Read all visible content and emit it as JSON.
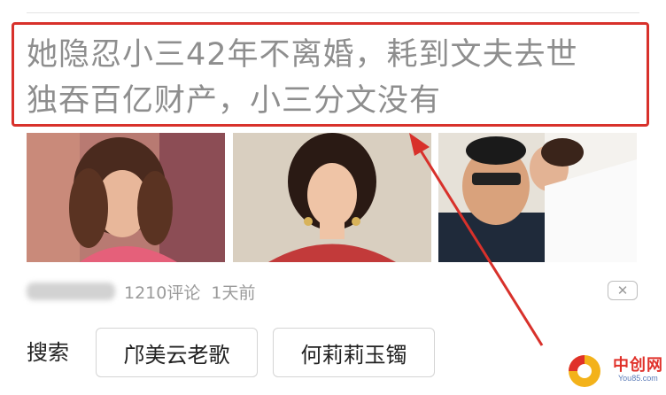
{
  "article": {
    "headline_line1": "她隐忍小三42年不离婚，耗到文夫去世",
    "headline_line2": "独吞百亿财产，小三分文没有"
  },
  "meta": {
    "comments": "1210评论",
    "time": "1天前",
    "close_glyph": "✕"
  },
  "search": {
    "label": "搜索",
    "suggestions": [
      "邝美云老歌",
      "何莉莉玉镯"
    ]
  },
  "watermark": {
    "text": "中创网",
    "sub": "You85.com"
  },
  "colors": {
    "highlight": "#d8312b",
    "headline_text": "#8e8e8e",
    "meta_text": "#9a9a9a"
  }
}
